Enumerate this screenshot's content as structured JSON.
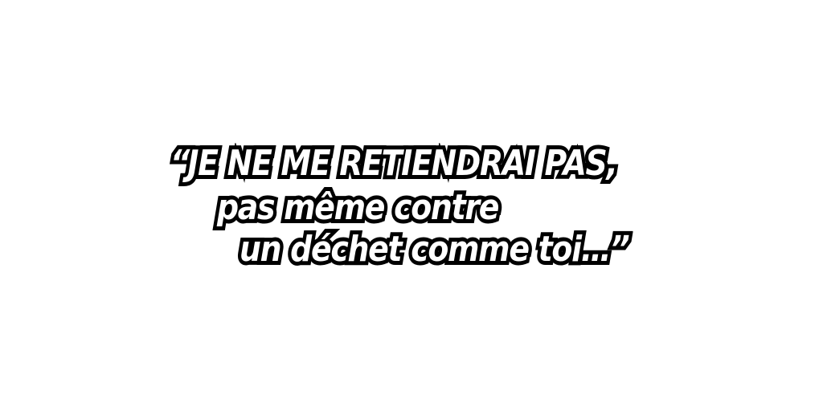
{
  "quote": {
    "lines": [
      "“JE NE ME RETIENDRAI PAS,",
      "pas même contre",
      "un déchet comme toi…”"
    ]
  },
  "colors": {
    "background": "#ffffff",
    "text_fill": "#ffffff",
    "text_outline": "#000000"
  }
}
